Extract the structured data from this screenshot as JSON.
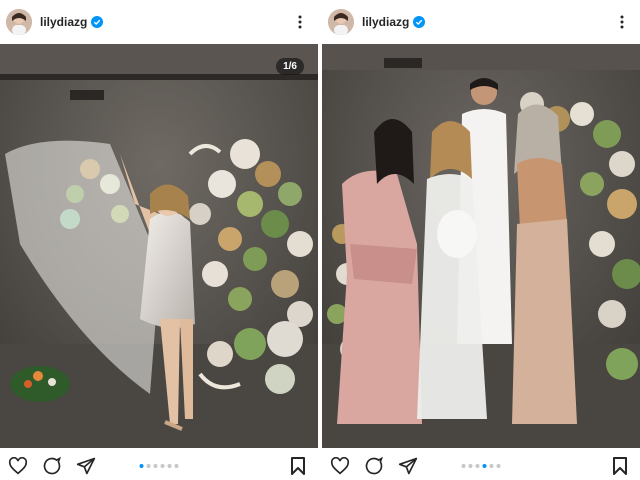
{
  "posts": [
    {
      "username": "lilydiazg",
      "photo_counter": "1/6",
      "total_photos": 6,
      "active_index": 0
    },
    {
      "username": "lilydiazg",
      "photo_counter": "",
      "total_photos": 6,
      "active_index": 3
    }
  ],
  "icons": {
    "verified": "verified-badge-icon",
    "more": "more-options-icon",
    "like": "heart-icon",
    "comment": "comment-icon",
    "share": "send-icon",
    "save": "bookmark-icon"
  },
  "colors": {
    "verified_blue": "#0095f6",
    "active_dot": "#0095f6",
    "inactive_dot": "#c7c7c7",
    "text": "#262626"
  }
}
